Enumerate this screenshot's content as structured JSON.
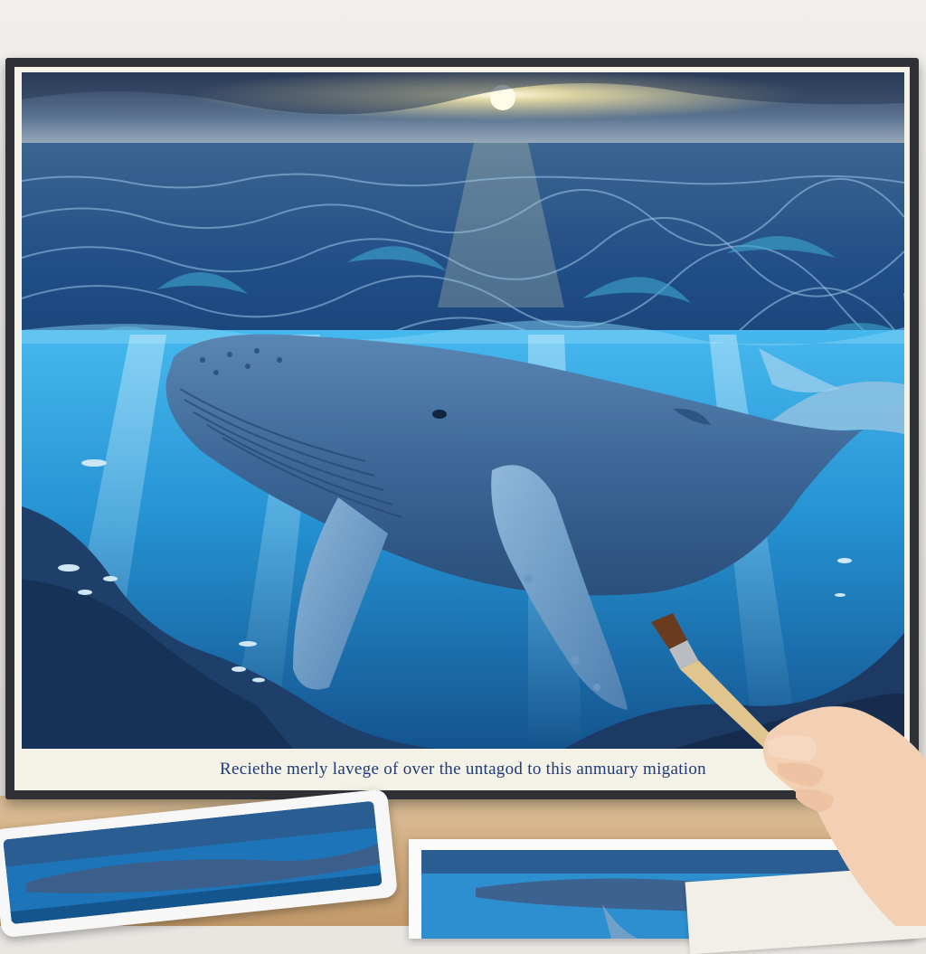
{
  "artwork": {
    "caption": "Reciethe merly lavege of over the untagod to this  anmuary migation",
    "subject": "humpback-whale",
    "palette": {
      "sky": "#3d5a80",
      "sun": "#fff6c8",
      "ocean_surface": "#1f4e86",
      "underwater": "#2fa6e0",
      "whale": "#3f6a9a",
      "caption_text": "#1f3a78",
      "frame": "#2f3136",
      "mat": "#f4f1e6"
    }
  },
  "props": {
    "tablet": "tablet-showing-whale",
    "print": "photo-print-of-whale",
    "brush": "paintbrush-icon",
    "hand": "hand"
  }
}
